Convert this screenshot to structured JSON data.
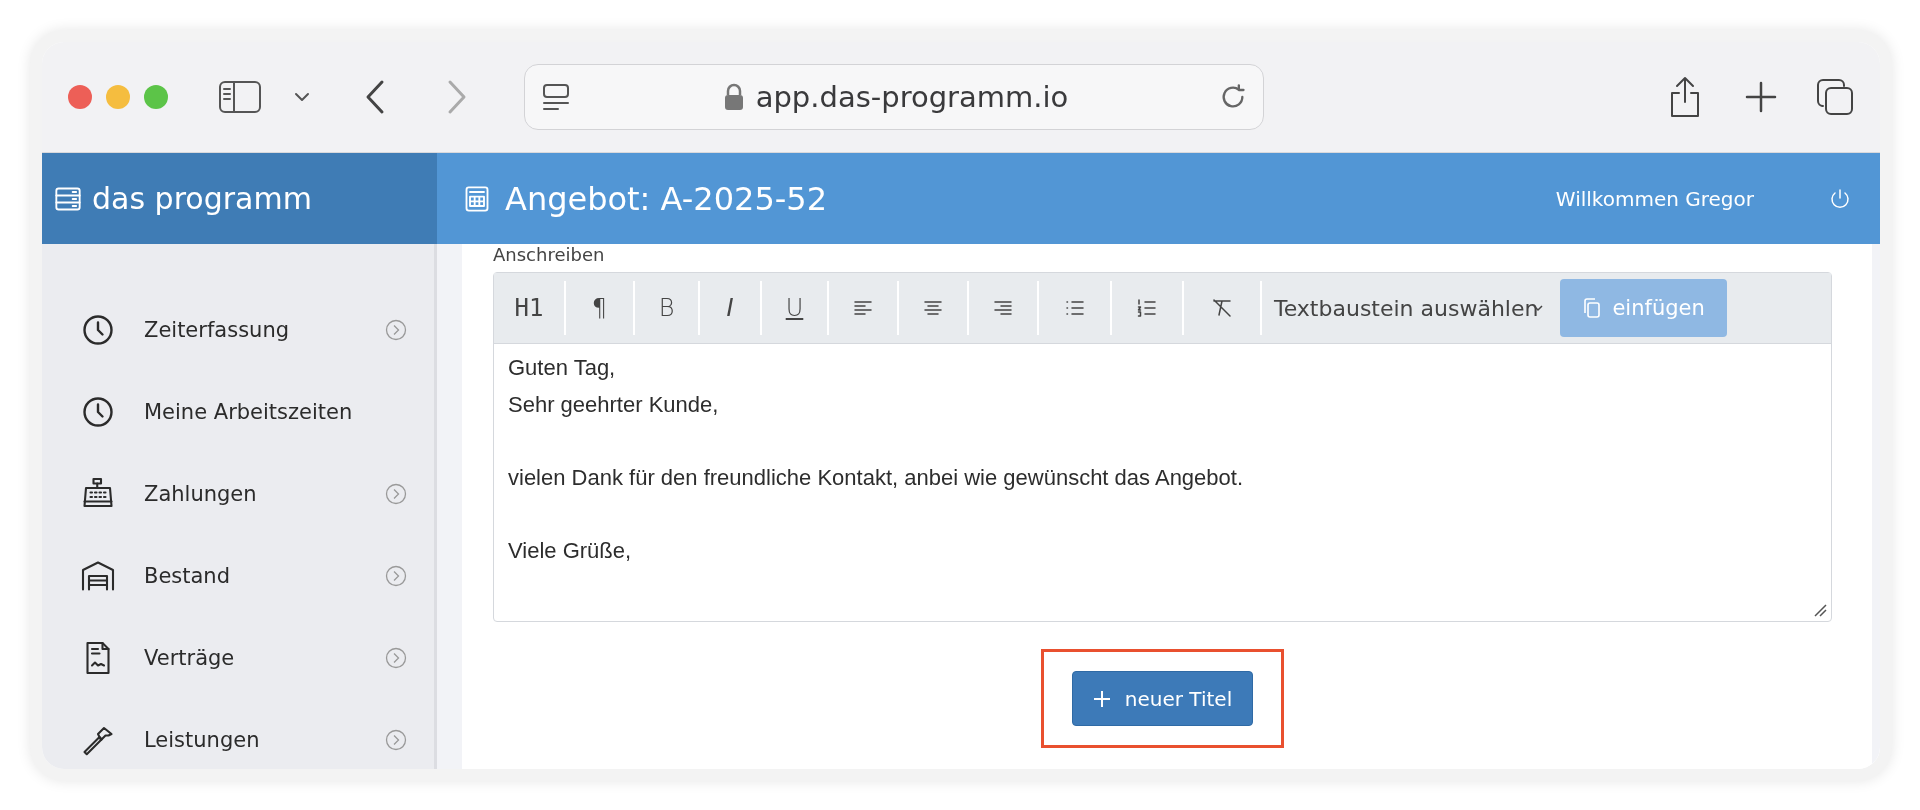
{
  "browser": {
    "url": "app.das-programm.io"
  },
  "app": {
    "brand": "das programm",
    "title": "Angebot: A-2025-52",
    "welcome": "Willkommen Gregor"
  },
  "sidebar": {
    "items": [
      {
        "label": "Zeiterfassung",
        "has_submenu": true
      },
      {
        "label": "Meine Arbeitszeiten",
        "has_submenu": false
      },
      {
        "label": "Zahlungen",
        "has_submenu": true
      },
      {
        "label": "Bestand",
        "has_submenu": true
      },
      {
        "label": "Verträge",
        "has_submenu": true
      },
      {
        "label": "Leistungen",
        "has_submenu": true
      }
    ]
  },
  "editor": {
    "label": "Anschreiben",
    "toolbar": [
      {
        "kind": "text",
        "text": "H1"
      },
      {
        "kind": "text",
        "text": "¶"
      },
      {
        "kind": "text",
        "text": "B"
      },
      {
        "kind": "text",
        "text": "I"
      },
      {
        "kind": "text",
        "text": "U"
      },
      {
        "kind": "icon"
      },
      {
        "kind": "icon"
      },
      {
        "kind": "icon"
      },
      {
        "kind": "icon"
      },
      {
        "kind": "icon"
      },
      {
        "kind": "icon"
      }
    ],
    "snippet_select": "Textbaustein auswählen",
    "insert_button": {
      "label": "einfügen",
      "disabled": true
    },
    "paragraphs": [
      [
        "Guten Tag,",
        "Sehr geehrter Kunde,"
      ],
      [
        "vielen Dank für den freundliche Kontakt, anbei wie gewünscht das Angebot."
      ],
      [
        "Viele Grüße,"
      ]
    ]
  },
  "new_title_button": {
    "label": "neuer Titel",
    "highlighted": true
  }
}
